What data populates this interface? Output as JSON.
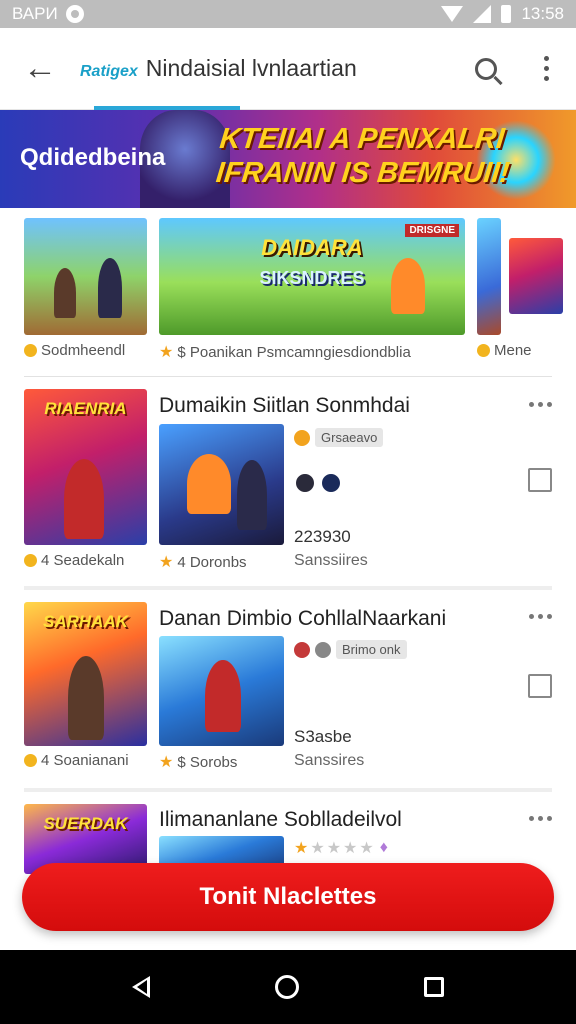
{
  "status_bar": {
    "left_text": "ВАРИ",
    "time": "13:58"
  },
  "app_bar": {
    "brand": "Ratigex",
    "title": "Nindaisial lvnlaartian"
  },
  "banner": {
    "left_text": "Qdidedbeina",
    "right_line1": "KTEIIAI A PENXALRI",
    "right_line2": "IFRANIN IS BEMRUII!"
  },
  "carousel": [
    {
      "meta_text": "Sodmheendl",
      "icon": "coin-icon"
    },
    {
      "img_title": "DAIDARA",
      "img_sub": "SIKSNDRES",
      "img_tag": "DRISGNE",
      "meta_text": "$ Poanikan  Psmcamngiesdiondblia",
      "icon": "star-icon"
    },
    {
      "meta_text": "Mene",
      "icon": "coin-icon"
    }
  ],
  "rows": [
    {
      "title": "Dumaikin  Siitlan Sonmhdai",
      "poster_label": "RIAENRIA",
      "chip_label": "Grsaeavo",
      "count": "223930",
      "sub_label": "Sanssiires",
      "meta_left": "4  Seadekaln",
      "meta_mid": "4  Doronbs"
    },
    {
      "title": "Danan Dimbio  CohllalNaarkani",
      "poster_label": "SARHAAK",
      "chip_label": "Brimo onk",
      "count": "S3asbe",
      "sub_label": "Sanssires",
      "meta_left": "4  Soanianani",
      "meta_mid": "$  Sorobs"
    },
    {
      "title": "Ilimananlane  Soblladeilvol",
      "poster_label": "SUERDAK",
      "rating": 1,
      "rating_max": 5
    }
  ],
  "cta": {
    "label": "Tonit Nlaclettes"
  },
  "colors": {
    "accent": "#2aa7d8",
    "cta": "#e01414",
    "star": "#f2a31e"
  }
}
